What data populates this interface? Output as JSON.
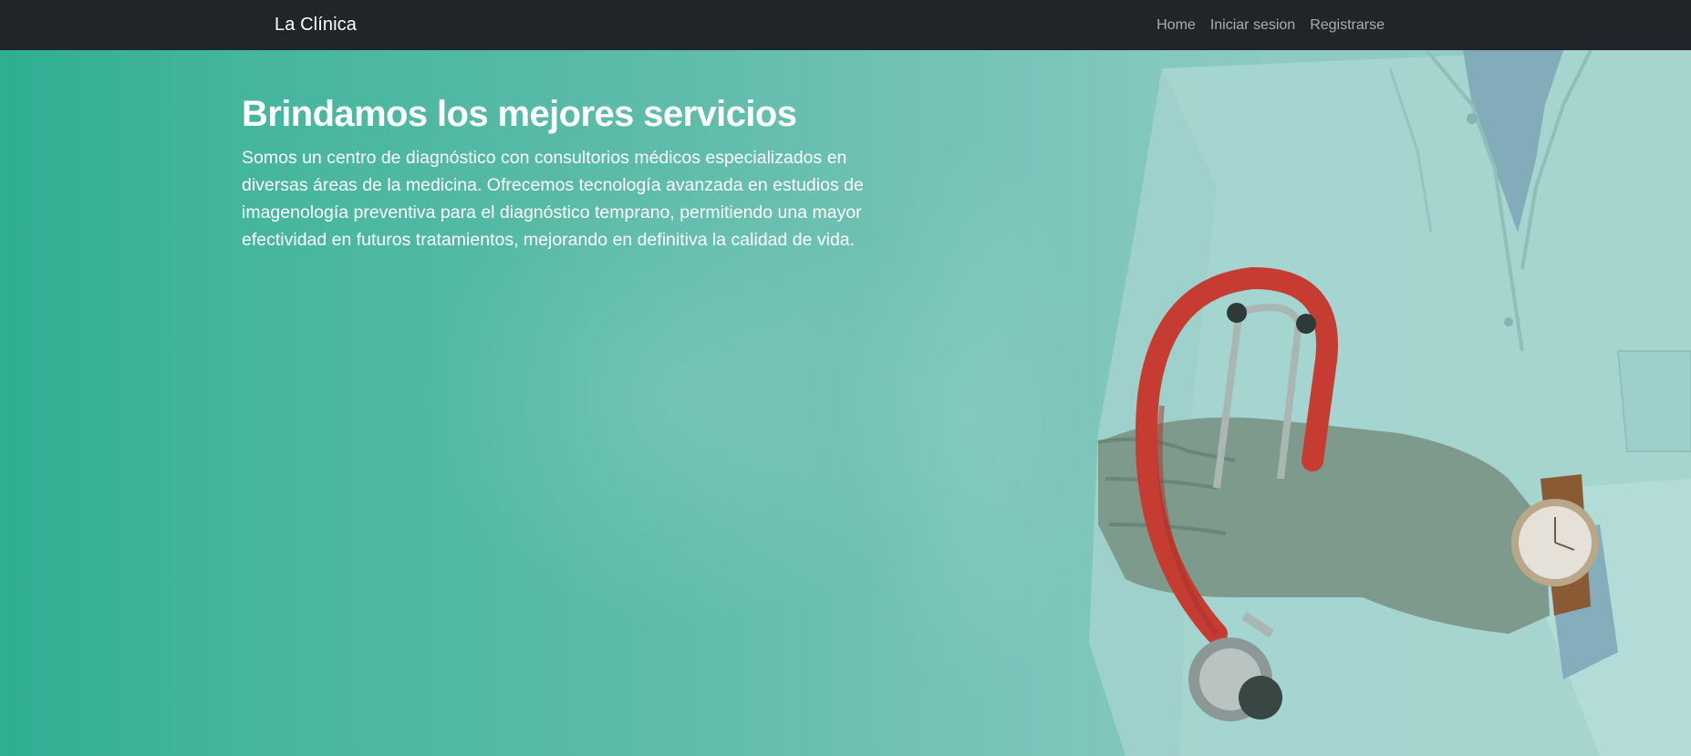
{
  "navbar": {
    "brand": "La Clínica",
    "links": [
      {
        "label": "Home"
      },
      {
        "label": "Iniciar sesion"
      },
      {
        "label": "Registrarse"
      }
    ]
  },
  "hero": {
    "title": "Brindamos los mejores servicios",
    "paragraph": "Somos un centro de diagnóstico con consultorios médicos especializados en diversas áreas de la medicina. Ofrecemos tecnología avanzada en estudios de imagenología preventiva para el diagnóstico temprano, permitiendo una mayor efectividad en futuros tratamientos, mejorando en definitiva la calidad de vida.",
    "image": "doctor-with-stethoscope-and-watch"
  },
  "colors": {
    "navbar_bg": "#212429",
    "hero_teal": "#2fae92",
    "hero_light": "#97cdc7",
    "stethoscope_red": "#c63c33"
  }
}
